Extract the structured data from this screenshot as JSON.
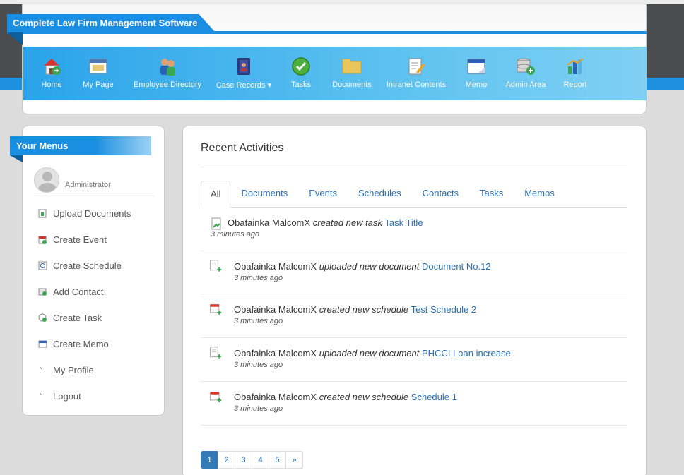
{
  "header": {
    "brand": "Complete Law Firm Management Software",
    "nav": [
      {
        "label": "Home",
        "icon": "home-icon"
      },
      {
        "label": "My Page",
        "icon": "window-icon"
      },
      {
        "label": "Employee Directory",
        "icon": "people-icon"
      },
      {
        "label": "Case Records ▾",
        "icon": "book-icon"
      },
      {
        "label": "Tasks",
        "icon": "checkmark-icon"
      },
      {
        "label": "Documents",
        "icon": "folder-icon"
      },
      {
        "label": "Intranet Contents",
        "icon": "note-edit-icon"
      },
      {
        "label": "Memo",
        "icon": "memo-window-icon"
      },
      {
        "label": "Admin Area",
        "icon": "database-add-icon"
      },
      {
        "label": "Report",
        "icon": "bar-chart-icon"
      }
    ]
  },
  "sidebar": {
    "title": "Your Menus",
    "user": "Administrator",
    "items": [
      {
        "label": "Upload Documents",
        "icon": "upload-icon"
      },
      {
        "label": "Create Event",
        "icon": "calendar-add-icon"
      },
      {
        "label": "Create Schedule",
        "icon": "schedule-icon"
      },
      {
        "label": "Add Contact",
        "icon": "contact-add-icon"
      },
      {
        "label": "Create Task",
        "icon": "task-add-icon"
      },
      {
        "label": "Create Memo",
        "icon": "memo-icon"
      },
      {
        "label": "My Profile",
        "icon": "profile-icon"
      },
      {
        "label": "Logout",
        "icon": "logout-icon"
      }
    ]
  },
  "main": {
    "title": "Recent Activities",
    "tabs": [
      "All",
      "Documents",
      "Events",
      "Schedules",
      "Contacts",
      "Tasks",
      "Memos"
    ],
    "activities": [
      {
        "user": "Obafainka MalcomX",
        "action": "created new task",
        "target": "Task Title",
        "time": "3 minutes ago",
        "icon": "task-icon"
      },
      {
        "user": "Obafainka MalcomX",
        "action": "uploaded new document",
        "target": "Document No.12",
        "time": "3 minutes ago",
        "icon": "document-add-icon"
      },
      {
        "user": "Obafainka MalcomX",
        "action": "created new schedule",
        "target": "Test Schedule 2",
        "time": "3 minutes ago",
        "icon": "calendar-add-icon"
      },
      {
        "user": "Obafainka MalcomX",
        "action": "uploaded new document",
        "target": "PHCCI Loan increase",
        "time": "3 minutes ago",
        "icon": "document-add-icon"
      },
      {
        "user": "Obafainka MalcomX",
        "action": "created new schedule",
        "target": "Schedule 1",
        "time": "3 minutes ago",
        "icon": "calendar-add-icon"
      }
    ],
    "pagination": [
      "1",
      "2",
      "3",
      "4",
      "5",
      "»"
    ]
  },
  "colors": {
    "accent": "#1a8ee0",
    "link": "#2a6fb4",
    "active_page": "#337ab7"
  }
}
